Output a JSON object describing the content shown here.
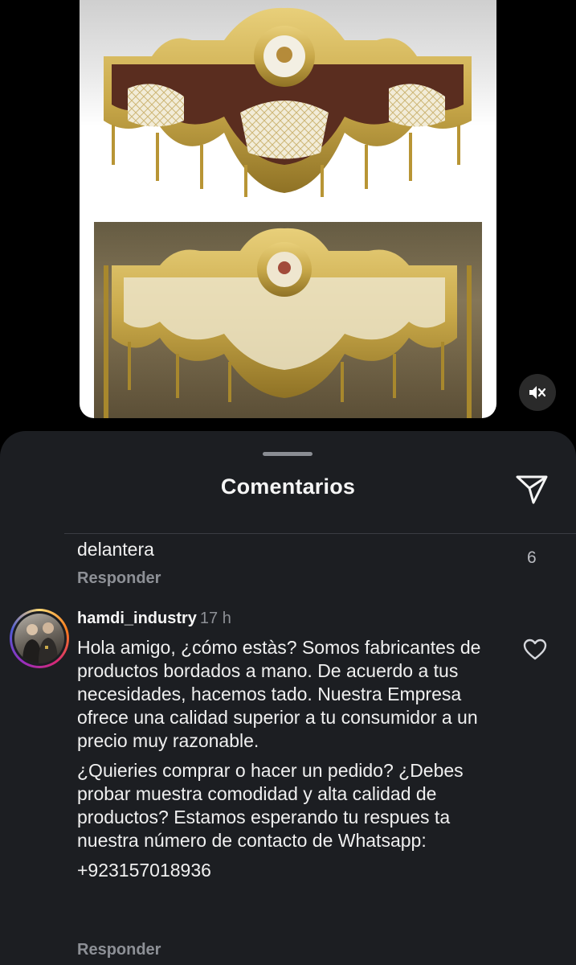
{
  "media": {
    "mute_icon": "speaker-muted-icon"
  },
  "sheet": {
    "title": "Comentarios",
    "share_icon": "send-icon"
  },
  "previous_comment": {
    "text_tail": "delantera",
    "like_count": "6",
    "reply_label": "Responder"
  },
  "comment": {
    "username": "hamdi_industry",
    "timestamp": "17 h",
    "paragraphs": [
      "Hola amigo, ¿cómo estàs? Somos fabricantes de productos bordados a mano. De acuerdo a tus necesidades, hacemos tado. Nuestra Empresa ofrece una calidad superior a tu consumidor a un precio muy razonable.",
      "¿Quieries comprar o hacer un pedido? ¿Debes probar muestra comodidad y alta calidad de productos? Estamos esperando tu respues ta nuestra número de contacto de Whatsapp:",
      "+923157018936"
    ],
    "reply_label": "Responder",
    "like_icon": "heart-outline-icon"
  },
  "colors": {
    "sheet_bg": "#1c1e22",
    "muted_text": "#8d9096",
    "gold": "#c9a94a"
  }
}
